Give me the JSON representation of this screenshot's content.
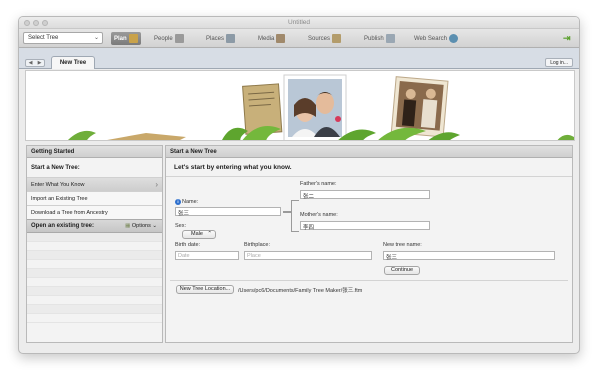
{
  "window": {
    "title": "Untitled"
  },
  "toolbar": {
    "tree_select": "Select Tree",
    "nav": [
      {
        "label": "Plan",
        "icon": "plan-icon",
        "color": "#c9a24a"
      },
      {
        "label": "People",
        "icon": "people-icon",
        "color": "#9a9a9a"
      },
      {
        "label": "Places",
        "icon": "places-icon",
        "color": "#8c9aa6"
      },
      {
        "label": "Media",
        "icon": "media-icon",
        "color": "#a0896b"
      },
      {
        "label": "Sources",
        "icon": "sources-icon",
        "color": "#b39c6b"
      },
      {
        "label": "Publish",
        "icon": "publish-icon",
        "color": "#9aa7b3"
      },
      {
        "label": "Web Search",
        "icon": "web-search-icon",
        "color": "#5b8fb0"
      }
    ]
  },
  "tabs": {
    "active": "New Tree",
    "login": "Log in..."
  },
  "left_panel": {
    "header": "Getting Started",
    "start_title": "Start a New Tree:",
    "items": [
      "Enter What You Know",
      "Import an Existing Tree",
      "Download a Tree from Ancestry"
    ],
    "open_title": "Open an existing tree:",
    "options_label": "Options"
  },
  "right_panel": {
    "header": "Start a New Tree",
    "lead": "Let's start by entering what you know.",
    "name_label": "Name:",
    "name_value": "张三",
    "sex_label": "Sex:",
    "sex_value": "Male",
    "father_label": "Father's name:",
    "father_value": "张二",
    "mother_label": "Mother's name:",
    "mother_value": "李四",
    "birth_date_label": "Birth date:",
    "birth_date_placeholder": "Date",
    "birthplace_label": "Birthplace:",
    "birthplace_placeholder": "Place",
    "tree_name_label": "New tree name:",
    "tree_name_value": "张三",
    "continue_label": "Continue",
    "location_button": "New Tree Location...",
    "location_path": "/Users/pc6/Documents/Family Tree Maker/张三.ftm"
  }
}
